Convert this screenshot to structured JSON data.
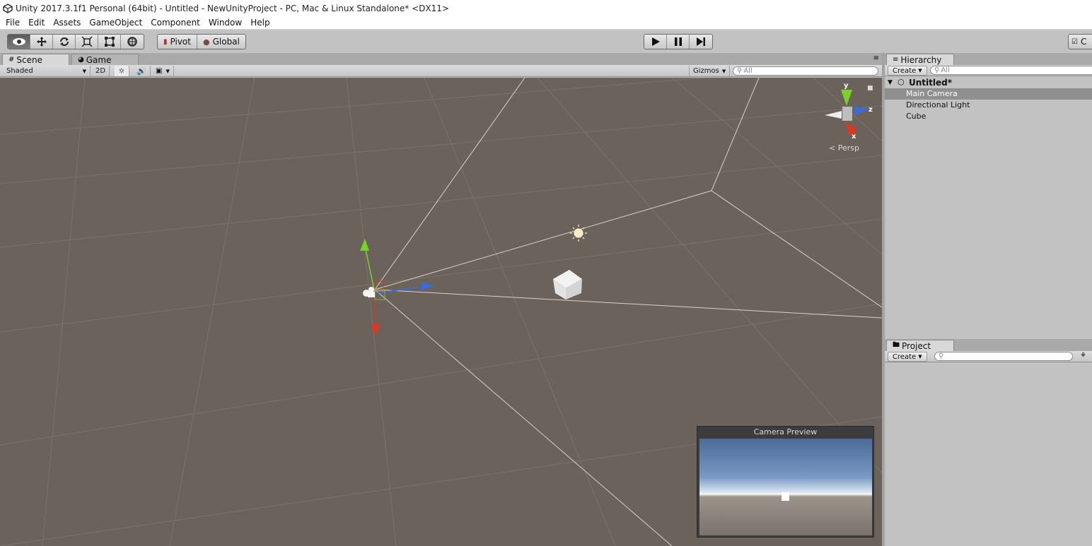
{
  "window": {
    "title": "Unity 2017.3.1f1 Personal (64bit) - Untitled - NewUnityProject - PC, Mac & Linux Standalone* <DX11>"
  },
  "menu": [
    "File",
    "Edit",
    "Assets",
    "GameObject",
    "Component",
    "Window",
    "Help"
  ],
  "toolbar": {
    "tools": [
      {
        "name": "hand-tool",
        "icon": "eye-icon",
        "active": true
      },
      {
        "name": "move-tool",
        "icon": "move-arrows-icon",
        "active": false
      },
      {
        "name": "rotate-tool",
        "icon": "rotate-icon",
        "active": false
      },
      {
        "name": "scale-tool",
        "icon": "scale-icon",
        "active": false
      },
      {
        "name": "rect-tool",
        "icon": "rect-icon",
        "active": false
      },
      {
        "name": "transform-tool",
        "icon": "transform-icon",
        "active": false
      }
    ],
    "pivot_label": "Pivot",
    "global_label": "Global",
    "collab_label": "C"
  },
  "scene_tabs": {
    "scene": "Scene",
    "game": "Game"
  },
  "scene_bar": {
    "shading": "Shaded",
    "mode_2d": "2D",
    "gizmos": "Gizmos",
    "search_placeholder": "All"
  },
  "gizmo": {
    "y": "y",
    "z": "z",
    "x": "x",
    "projection": "Persp"
  },
  "camera_preview": {
    "title": "Camera Preview"
  },
  "hierarchy": {
    "tab": "Hierarchy",
    "create": "Create",
    "search_placeholder": "All",
    "scene_name": "Untitled*",
    "items": [
      "Main Camera",
      "Directional Light",
      "Cube"
    ],
    "selected_index": 0
  },
  "project": {
    "tab": "Project",
    "create": "Create"
  },
  "colors": {
    "scene_bg": "#6a625b",
    "axis_x": "#d63b20",
    "axis_y": "#7bd12a",
    "axis_z": "#3a6bd8",
    "panel_bg": "#c2c2c2",
    "selection": "#8f8f8f"
  }
}
